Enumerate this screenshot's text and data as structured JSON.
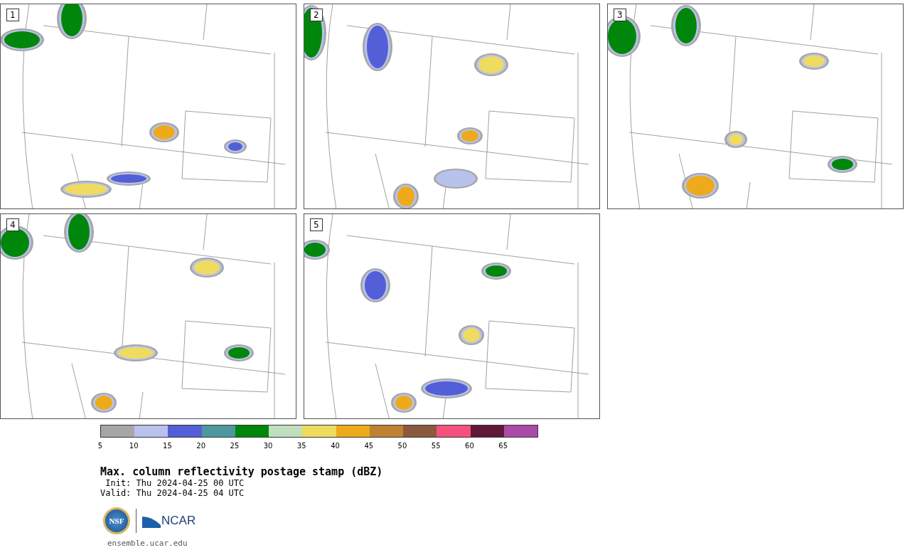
{
  "panels": [
    {
      "label": "1"
    },
    {
      "label": "2"
    },
    {
      "label": "3"
    },
    {
      "label": "4"
    },
    {
      "label": "5"
    }
  ],
  "colorbar": {
    "segments": [
      {
        "color": "#a6a6a6"
      },
      {
        "color": "#b8c2ec"
      },
      {
        "color": "#525fd6"
      },
      {
        "color": "#4e979f"
      },
      {
        "color": "#00860a"
      },
      {
        "color": "#c0dfbe"
      },
      {
        "color": "#efdb5f"
      },
      {
        "color": "#efaa1b"
      },
      {
        "color": "#bf8230"
      },
      {
        "color": "#8b5a3e"
      },
      {
        "color": "#f5517e"
      },
      {
        "color": "#601838"
      },
      {
        "color": "#ab4ba7"
      }
    ],
    "ticks": [
      "5",
      "10",
      "15",
      "20",
      "25",
      "30",
      "35",
      "40",
      "45",
      "50",
      "55",
      "60",
      "65"
    ]
  },
  "title": "Max. column reflectivity postage stamp (dBZ)",
  "init": " Init: Thu 2024-04-25 00 UTC",
  "valid": "Valid: Thu 2024-04-25 04 UTC",
  "logos": {
    "nsf": "NSF",
    "ncar": "NCAR"
  },
  "url": "ensemble.ucar.edu"
}
